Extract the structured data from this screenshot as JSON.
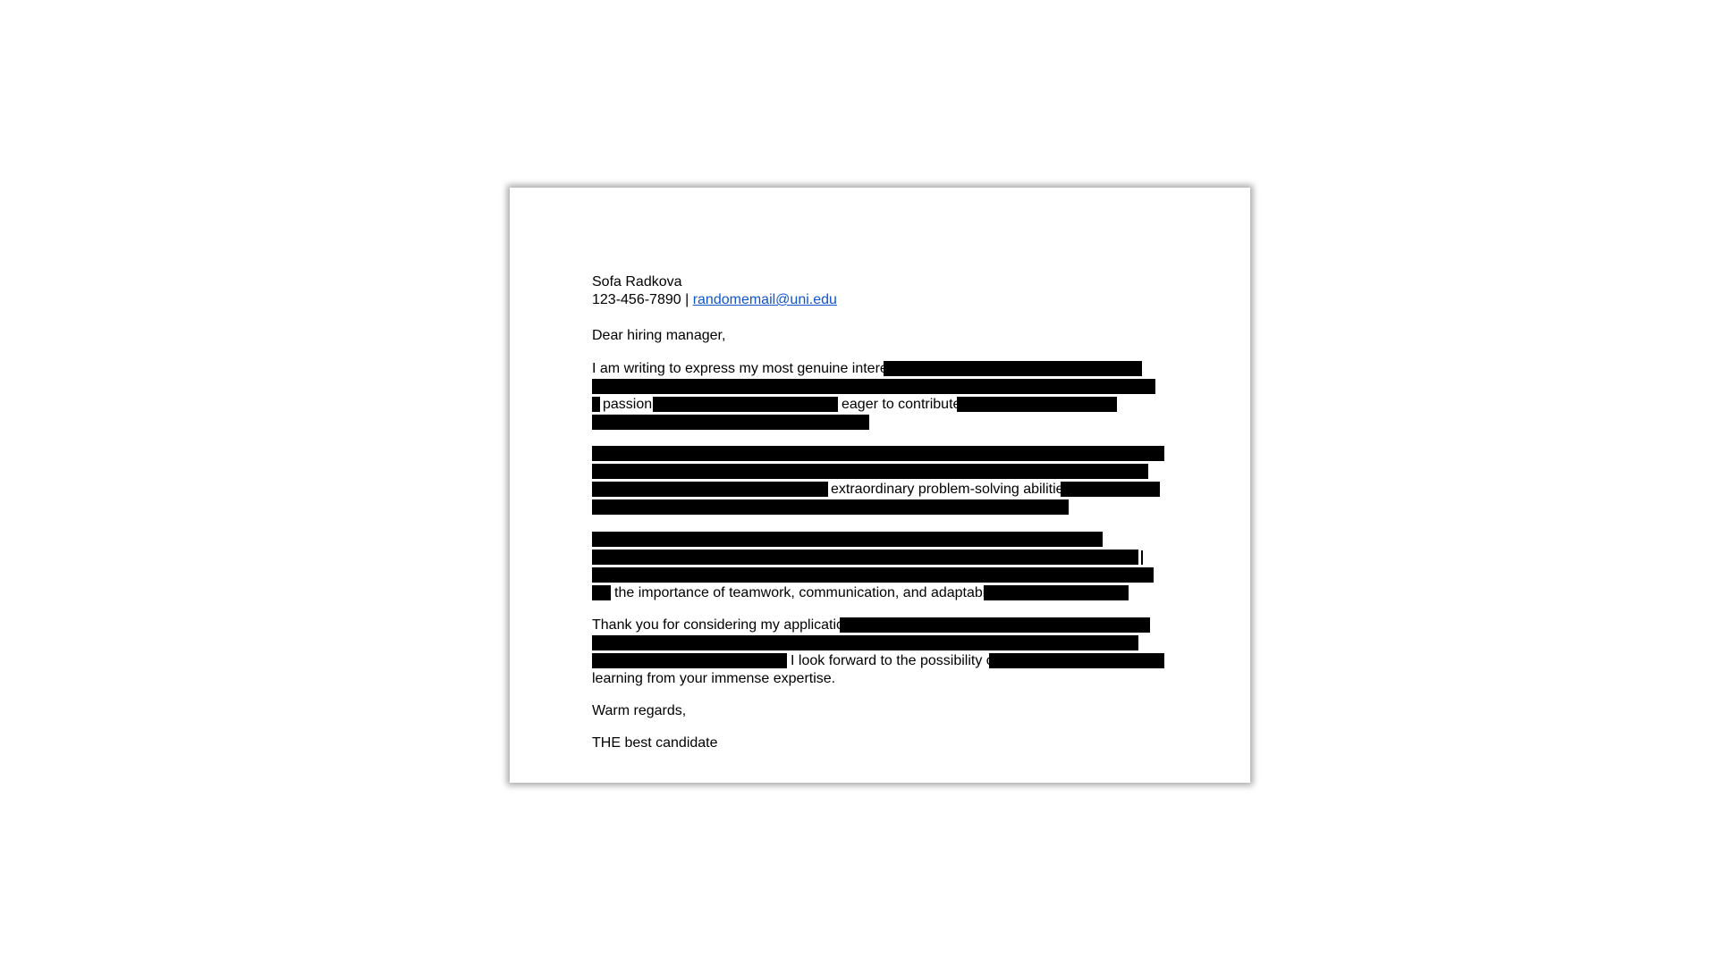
{
  "header": {
    "name": "Sofa Radkova",
    "phone": "123-456-7890",
    "separator": " | ",
    "email": "randomemail@uni.edu"
  },
  "salutation": "Dear hiring manager,",
  "paragraph1": {
    "text_a": "I am writing to express my most genuine interest",
    "text_b": "passion",
    "text_c": "eager to contribute"
  },
  "paragraph2": {
    "text_a": "extraordinary problem-solving abilities"
  },
  "paragraph3": {
    "text_a": "the importance of teamwork, communication, and adaptability"
  },
  "paragraph4": {
    "text_a": "Thank you for considering my application.",
    "text_b": "I look forward to the possibility of",
    "text_c": "learning from your immense expertise."
  },
  "closing": "Warm regards,",
  "signature": "THE best candidate"
}
